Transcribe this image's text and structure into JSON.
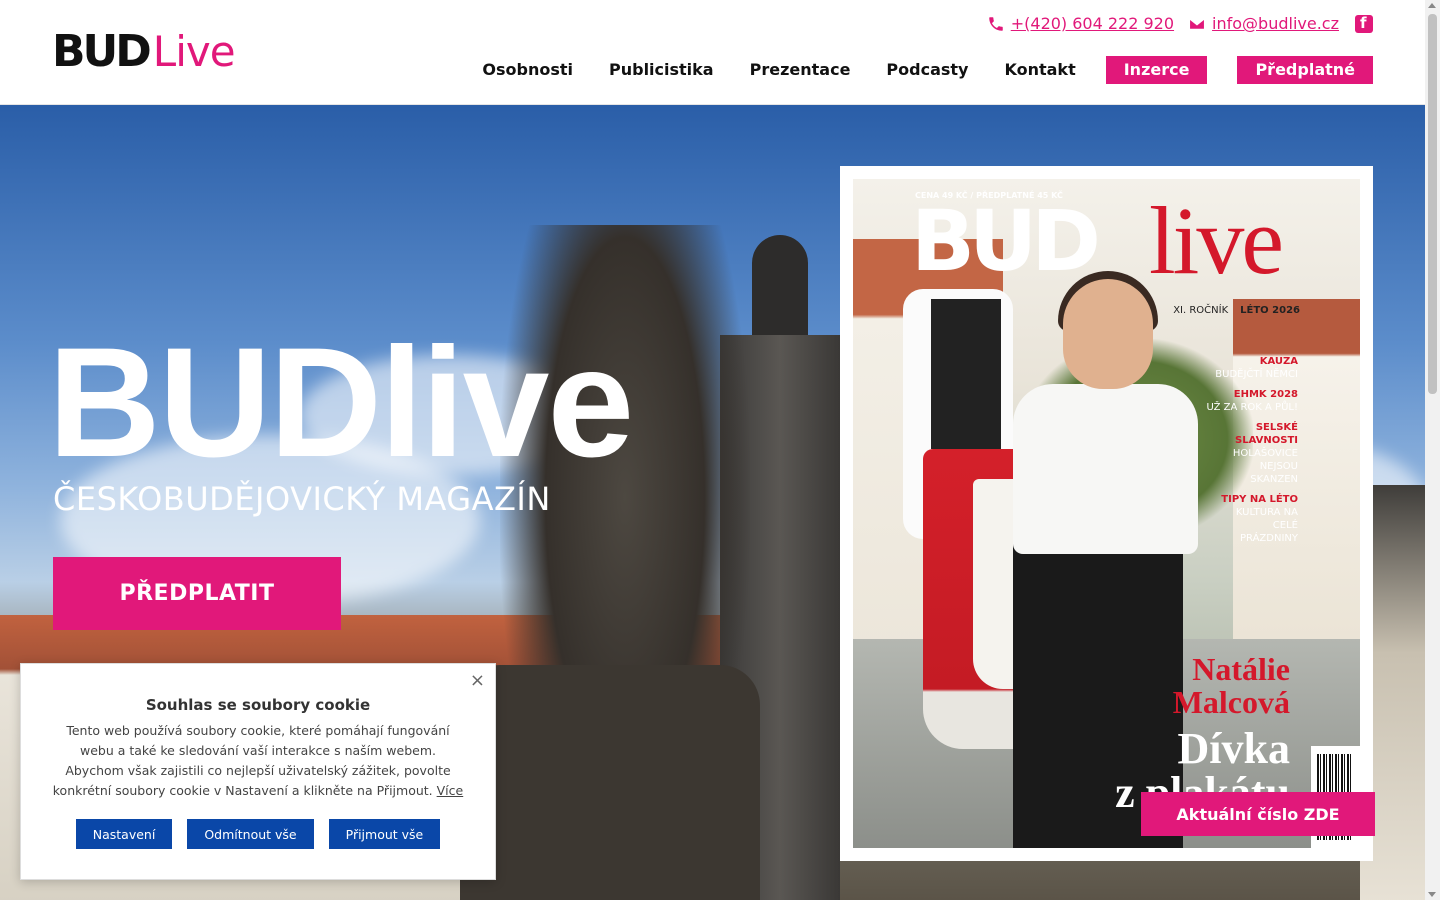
{
  "brand": {
    "bud": "BUD",
    "live": "Live",
    "accent": "#e1187a"
  },
  "contact": {
    "phone": "+(420) 604 222 920",
    "email": "info@budlive.cz",
    "phone_icon": "phone-icon",
    "email_icon": "envelope-icon",
    "social_icon": "facebook-icon"
  },
  "nav": {
    "links": [
      "Osobnosti",
      "Publicistika",
      "Prezentace",
      "Podcasty",
      "Kontakt"
    ],
    "buttons": [
      "Inzerce",
      "Předplatné"
    ]
  },
  "hero": {
    "title": "BUDlive",
    "subtitle": "ČESKOBUDĚJOVICKÝ MAGAZÍN",
    "cta": "PŘEDPLATIT"
  },
  "cover": {
    "price": "CENA 49 KČ / PŘEDPLATNÉ 45 KČ",
    "bud": "BUD",
    "live": "live",
    "issue_volume": "XI. ROČNÍK",
    "issue_season": "LÉTO 2026",
    "headlines": [
      {
        "red": "KAUZA",
        "white": "BUDĚJČTÍ NĚMCI"
      },
      {
        "red": "EHMK 2028",
        "white": "UŽ ZA ROK A PŮL!"
      },
      {
        "red": "SELSKÉ SLAVNOSTI",
        "white": "HOLAŠOVICE NEJSOU SKANZEN"
      },
      {
        "red": "TIPY NA LÉTO",
        "white": "KULTURA NA CELÉ PRÁZDNINY"
      }
    ],
    "name_line1": "Natálie",
    "name_line2": "Malcová",
    "tag_line1": "Dívka",
    "tag_line2": "z plakátu"
  },
  "current_issue_button": "Aktuální číslo ZDE",
  "cookie": {
    "title": "Souhlas se soubory cookie",
    "text": "Tento web používá soubory cookie, které pomáhají fungování webu a také ke sledování vaší interakce s naším webem. Abychom však zajistili co nejlepší uživatelský zážitek, povolte konkrétní soubory cookie v Nastavení a klikněte na Přijmout.",
    "more_link": "Více",
    "close_symbol": "×",
    "buttons": [
      "Nastavení",
      "Odmítnout vše",
      "Přijmout vše"
    ]
  }
}
